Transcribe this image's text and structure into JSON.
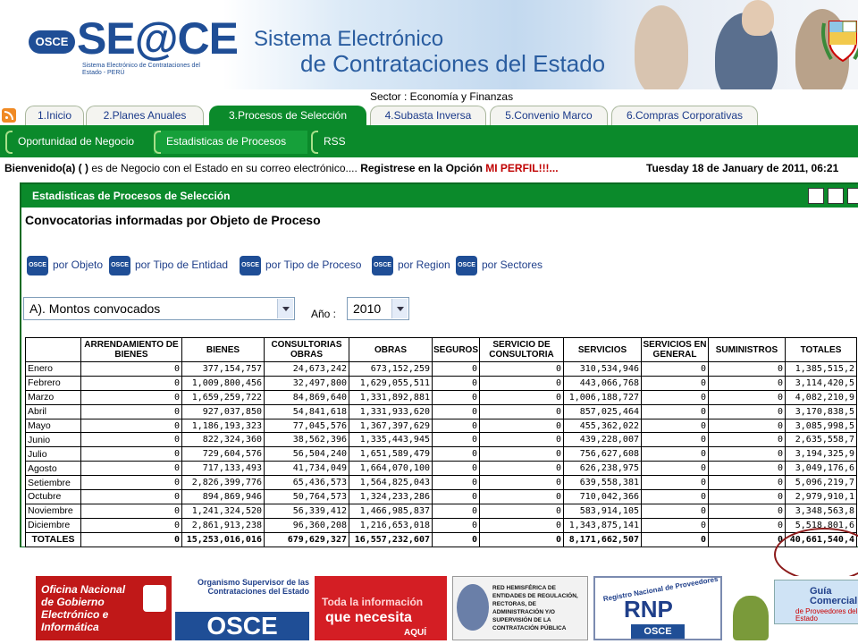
{
  "header": {
    "osce_badge": "OSCE",
    "logo": "SE@CE",
    "logo_sub": "Sistema Electrónico de Contrataciones del Estado - PERÚ",
    "title_line1": "Sistema Electrónico",
    "title_line2": "de Contrataciones del Estado",
    "sector": "Sector : Economía y Finanzas"
  },
  "tabs": [
    {
      "label": "1.Inicio"
    },
    {
      "label": "2.Planes Anuales"
    },
    {
      "label": "3.Procesos de Selección"
    },
    {
      "label": "4.Subasta Inversa"
    },
    {
      "label": "5.Convenio Marco"
    },
    {
      "label": "6.Compras Corporativas"
    }
  ],
  "subtabs": [
    {
      "label": "Oportunidad de Negocio"
    },
    {
      "label": "Estadisticas de Procesos"
    },
    {
      "label": "RSS"
    }
  ],
  "welcome": {
    "prefix": "Bienvenido(a) ( )",
    "middle": " es de Negocio con el Estado en su correo electrónico.... ",
    "register": "Registrese en la Opción ",
    "perfil": "MI PERFIL!!!...",
    "date": "Tuesday 18 de January de 2011, 06:21"
  },
  "panel": {
    "title": "Estadisticas de Procesos de Selección",
    "section_title": "Convocatorias informadas por Objeto de Proceso",
    "link_icon": "OSCE",
    "links": [
      "por Objeto",
      "por Tipo de Entidad",
      "por Tipo de Proceso",
      "por Region",
      "por Sectores"
    ],
    "select_label": "A). Montos convocados",
    "year_label": "Año :",
    "year_value": "2010"
  },
  "table": {
    "headers": [
      "",
      "ARRENDAMIENTO DE BIENES",
      "BIENES",
      "CONSULTORIAS OBRAS",
      "OBRAS",
      "SEGUROS",
      "SERVICIO DE CONSULTORIA",
      "SERVICIOS",
      "SERVICIOS EN GENERAL",
      "SUMINISTROS",
      "TOTALES"
    ],
    "rows": [
      [
        "Enero",
        "0",
        "377,154,757",
        "24,673,242",
        "673,152,259",
        "0",
        "0",
        "310,534,946",
        "0",
        "0",
        "1,385,515,2"
      ],
      [
        "Febrero",
        "0",
        "1,009,800,456",
        "32,497,800",
        "1,629,055,511",
        "0",
        "0",
        "443,066,768",
        "0",
        "0",
        "3,114,420,5"
      ],
      [
        "Marzo",
        "0",
        "1,659,259,722",
        "84,869,640",
        "1,331,892,881",
        "0",
        "0",
        "1,006,188,727",
        "0",
        "0",
        "4,082,210,9"
      ],
      [
        "Abril",
        "0",
        "927,037,850",
        "54,841,618",
        "1,331,933,620",
        "0",
        "0",
        "857,025,464",
        "0",
        "0",
        "3,170,838,5"
      ],
      [
        "Mayo",
        "0",
        "1,186,193,323",
        "77,045,576",
        "1,367,397,629",
        "0",
        "0",
        "455,362,022",
        "0",
        "0",
        "3,085,998,5"
      ],
      [
        "Junio",
        "0",
        "822,324,360",
        "38,562,396",
        "1,335,443,945",
        "0",
        "0",
        "439,228,007",
        "0",
        "0",
        "2,635,558,7"
      ],
      [
        "Julio",
        "0",
        "729,604,576",
        "56,504,240",
        "1,651,589,479",
        "0",
        "0",
        "756,627,608",
        "0",
        "0",
        "3,194,325,9"
      ],
      [
        "Agosto",
        "0",
        "717,133,493",
        "41,734,049",
        "1,664,070,100",
        "0",
        "0",
        "626,238,975",
        "0",
        "0",
        "3,049,176,6"
      ],
      [
        "Setiembre",
        "0",
        "2,826,399,776",
        "65,436,573",
        "1,564,825,043",
        "0",
        "0",
        "639,558,381",
        "0",
        "0",
        "5,096,219,7"
      ],
      [
        "Octubre",
        "0",
        "894,869,946",
        "50,764,573",
        "1,324,233,286",
        "0",
        "0",
        "710,042,366",
        "0",
        "0",
        "2,979,910,1"
      ],
      [
        "Noviembre",
        "0",
        "1,241,324,520",
        "56,339,412",
        "1,466,985,837",
        "0",
        "0",
        "583,914,105",
        "0",
        "0",
        "3,348,563,8"
      ],
      [
        "Diciembre",
        "0",
        "2,861,913,238",
        "96,360,208",
        "1,216,653,018",
        "0",
        "0",
        "1,343,875,141",
        "0",
        "0",
        "5,518,801,6"
      ]
    ],
    "totals": [
      "TOTALES",
      "0",
      "15,253,016,016",
      "679,629,327",
      "16,557,232,607",
      "0",
      "0",
      "8,171,662,507",
      "0",
      "0",
      "40,661,540,4"
    ]
  },
  "footer": {
    "b1": "Oficina Nacional de Gobierno Electrónico e Informática",
    "b2_top": "Organismo Supervisor de las Contrataciones del Estado",
    "b2_big": "OSCE",
    "b3_l1": "Toda la información",
    "b3_l2": "que necesita",
    "b3_l3": "AQUÍ",
    "b4": "RED HEMISFÉRICA DE ENTIDADES DE REGULACIÓN, RECTORAS, DE ADMINISTRACIÓN Y/O SUPERVISIÓN DE LA CONTRATACIÓN PÚBLICA",
    "b5_arc": "Registro Nacional de Proveedores",
    "b5_big": "RNP",
    "b5_small": "OSCE",
    "b6_l1": "Guía Comercial",
    "b6_l2": "de Proveedores del Estado"
  }
}
